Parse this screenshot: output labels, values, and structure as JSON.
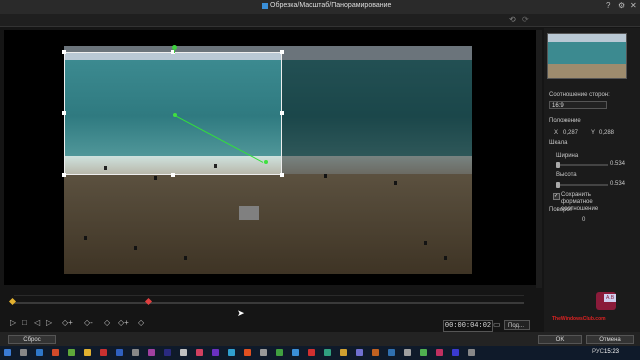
{
  "window": {
    "title": "Обрезка/Масштаб/Панорамирование",
    "help": "?",
    "settings_icon": "gear-icon",
    "close": "✕"
  },
  "toolbar": {
    "undo": "⟲",
    "redo": "⟳"
  },
  "playback": {
    "timecode": "00:00:04:02",
    "fit_option": "Под..."
  },
  "panel": {
    "aspect_label": "Соотношение сторон:",
    "aspect_value": "16:9",
    "position_label": "Положение",
    "x_label": "X",
    "x_value": "0,287",
    "y_label": "Y",
    "y_value": "0,288",
    "scale_label": "Шкала",
    "width_label": "Ширина",
    "width_value": "0.534",
    "height_label": "Высота",
    "height_value": "0.534",
    "keep_ratio_label": "Сохранить форматное соотношение",
    "keep_ratio_checked": true,
    "rotation_label": "Поворот",
    "rotation_value": "0"
  },
  "footer": {
    "reset": "Сброс",
    "ok": "OK",
    "cancel": "Отмена"
  },
  "taskbar": {
    "tray": "РУС",
    "time": "15:23"
  },
  "watermark": "TheWindowsClub.com",
  "colors": {
    "keyframe_start": "#e3b12f",
    "keyframe_current": "#e04040",
    "motion_path": "#33e03a"
  }
}
